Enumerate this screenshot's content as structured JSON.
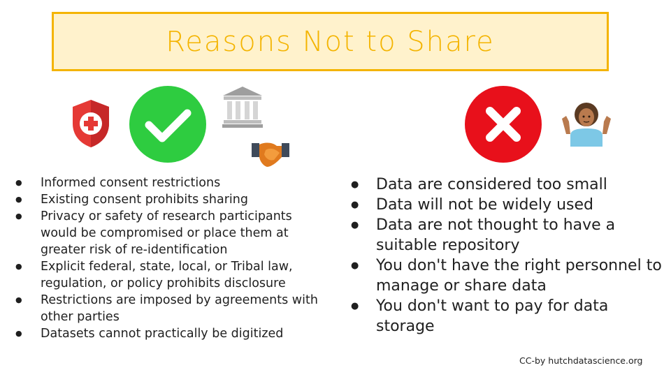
{
  "title": "Reasons Not to Share",
  "icons": {
    "shield": "shield-plus-icon",
    "check": "green-check-icon",
    "building": "government-building-icon",
    "handshake": "handshake-icon",
    "cross": "red-x-icon",
    "shrug": "shrugging-person-icon"
  },
  "colors": {
    "title_accent": "#f4b400",
    "title_background": "#fff2cc",
    "check_green": "#2ecc40",
    "cross_red": "#e8101b"
  },
  "left_list": [
    "Informed consent restrictions",
    "Existing consent prohibits sharing",
    "Privacy or safety of research participants would be compromised or place them at greater risk of re-identification",
    "Explicit federal, state, local, or Tribal law, regulation, or policy prohibits disclosure",
    "Restrictions are imposed by agreements with other parties",
    "Datasets cannot practically be digitized"
  ],
  "right_list": [
    "Data are considered too small",
    "Data will not be widely used",
    "Data are not thought to have a suitable repository",
    "You don't have the right personnel to manage or share data",
    "You don't want to pay for data storage"
  ],
  "credit": "CC-by hutchdatascience.org"
}
